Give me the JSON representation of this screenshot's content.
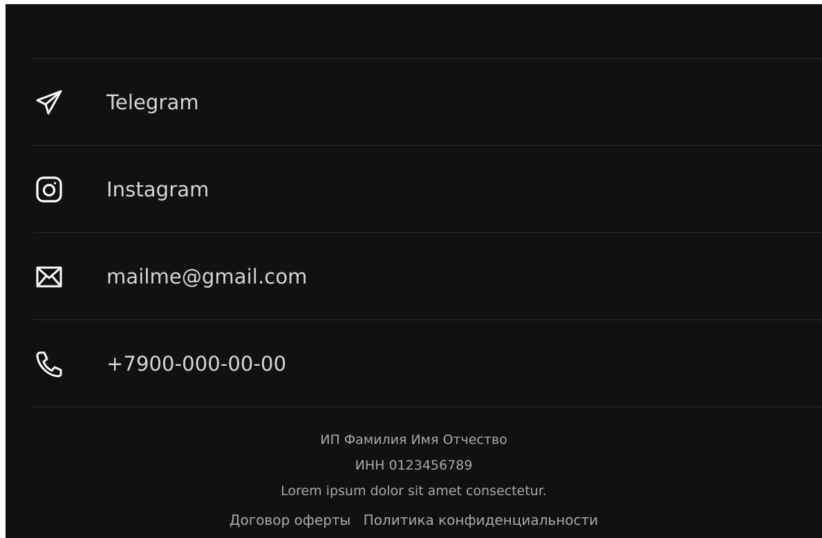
{
  "contacts": [
    {
      "icon": "telegram-icon",
      "label": "Telegram"
    },
    {
      "icon": "instagram-icon",
      "label": "Instagram"
    },
    {
      "icon": "mail-icon",
      "label": "mailme@gmail.com"
    },
    {
      "icon": "phone-icon",
      "label": "+7900-000-00-00"
    }
  ],
  "footer": {
    "owner": "ИП Фамилия Имя Отчество",
    "inn": "ИНН 0123456789",
    "tagline": "Lorem ipsum dolor sit amet consectetur.",
    "links": {
      "offer": "Договор оферты",
      "privacy": "Политика конфиденциальности"
    }
  },
  "colors": {
    "background": "#111111",
    "divider": "#2d2d2d",
    "text": "#d6d6d6",
    "footer_text": "#a9a9a9"
  }
}
